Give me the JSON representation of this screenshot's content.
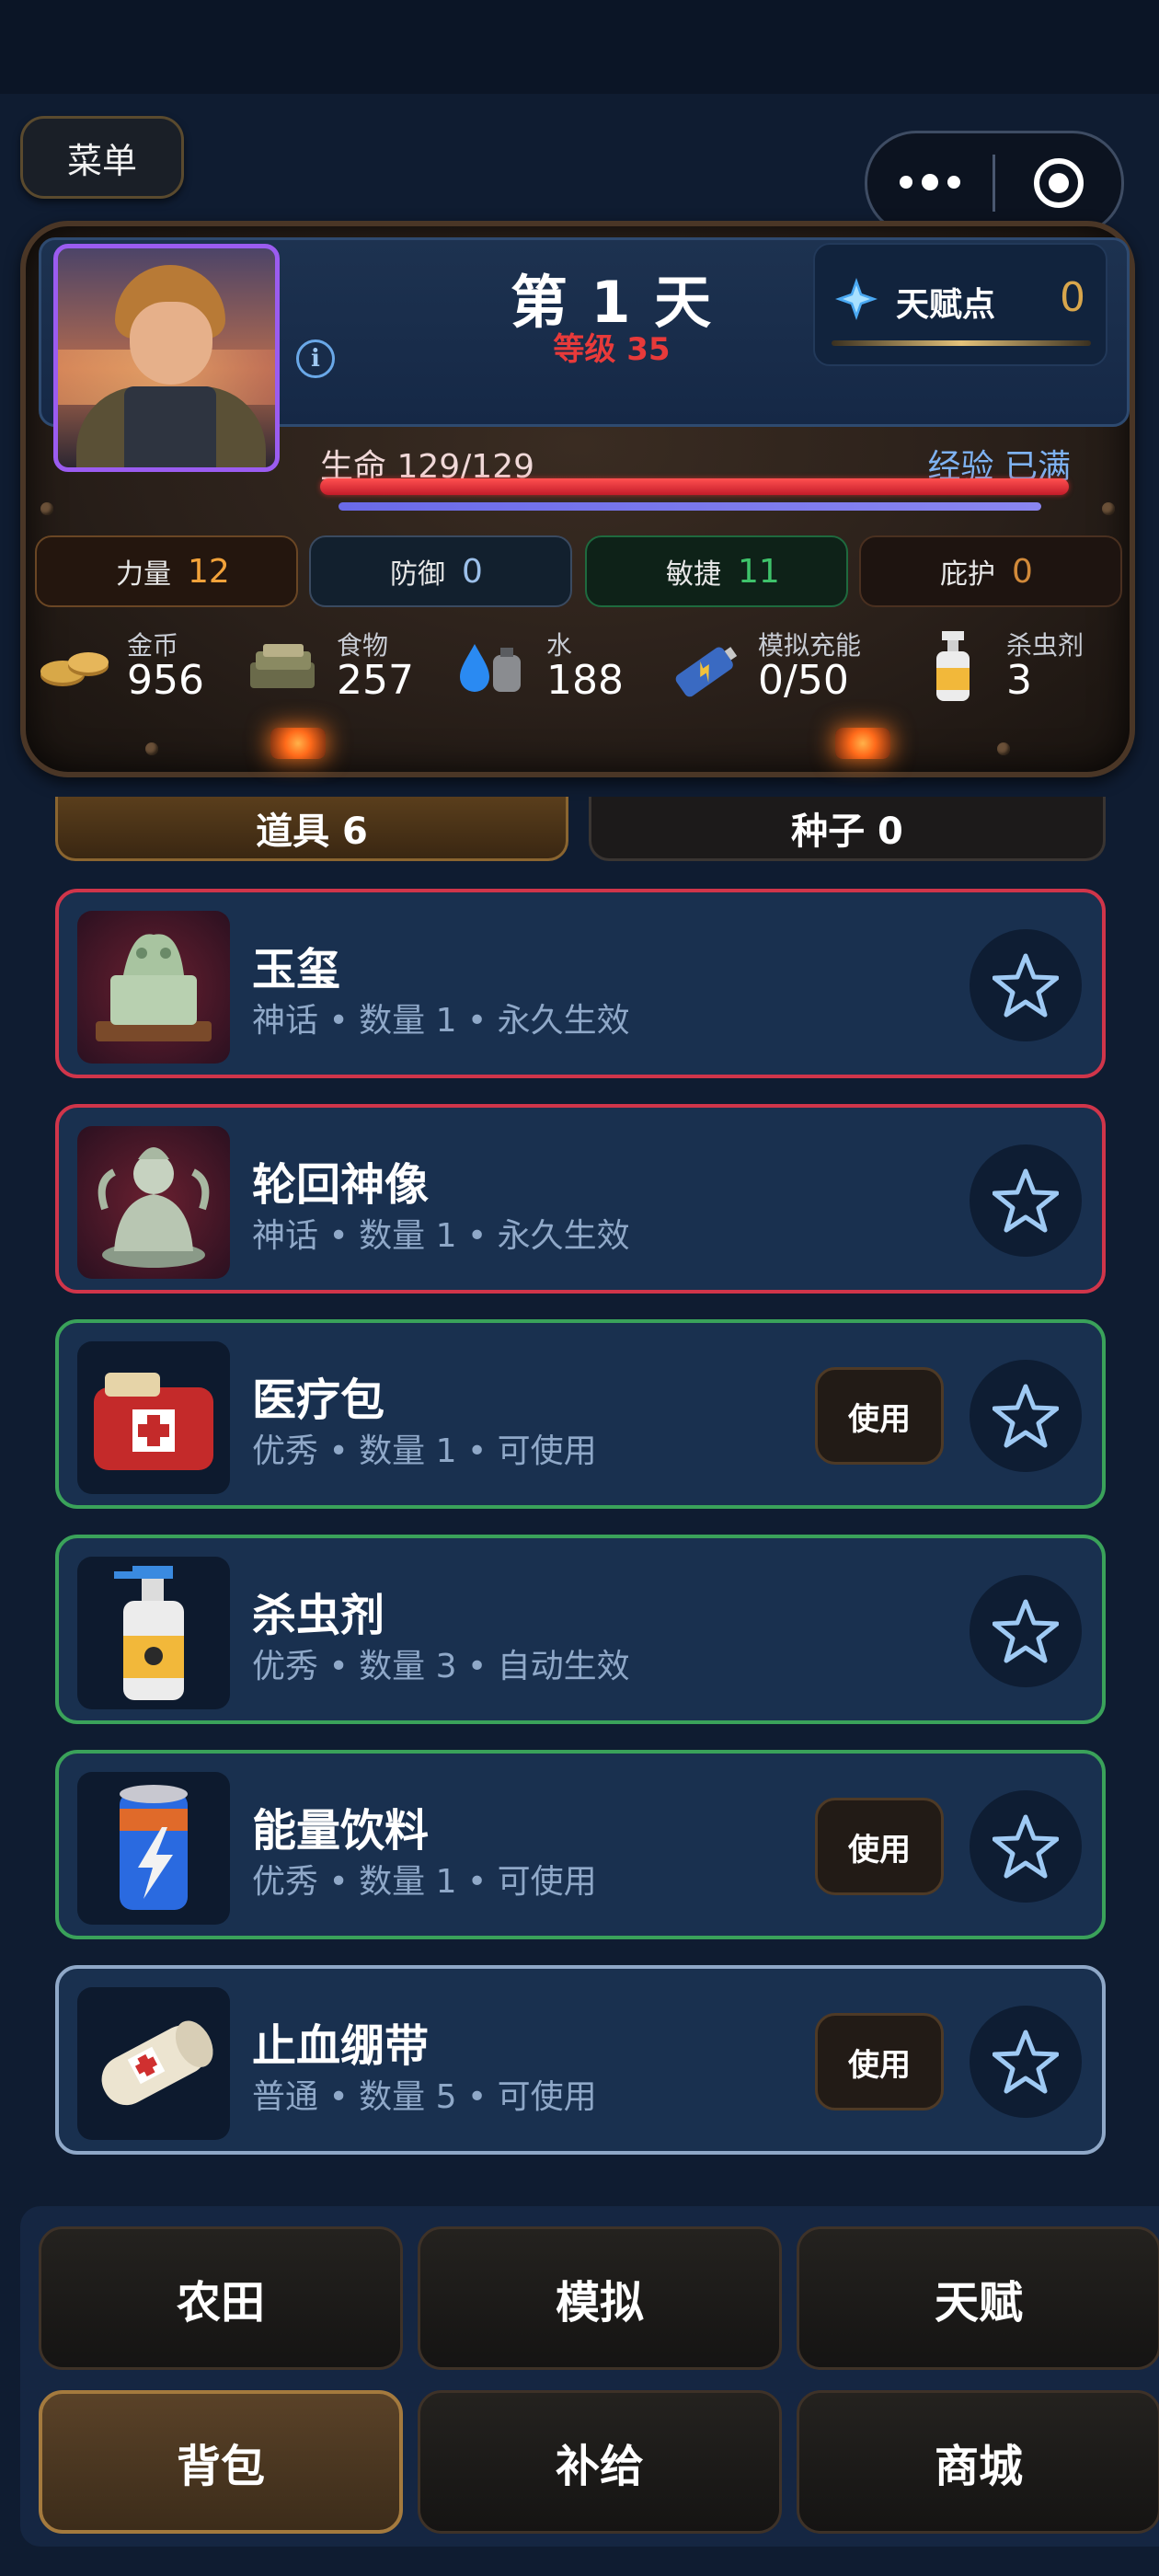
{
  "menu_label": "菜单",
  "player": {
    "day": "第 1 天",
    "level": "等级 35",
    "talent_label": "天赋点",
    "talent_points": "0",
    "hp_label": "生命 129/129",
    "exp_label": "经验 已满",
    "hp_fraction": 1.0,
    "exp_fraction": 1.0
  },
  "stats": [
    {
      "label": "力量",
      "value": "12"
    },
    {
      "label": "防御",
      "value": "0"
    },
    {
      "label": "敏捷",
      "value": "11"
    },
    {
      "label": "庇护",
      "value": "0"
    }
  ],
  "resources": [
    {
      "label": "金币",
      "value": "956",
      "icon": "coins-icon"
    },
    {
      "label": "食物",
      "value": "257",
      "icon": "food-icon"
    },
    {
      "label": "水",
      "value": "188",
      "icon": "water-icon"
    },
    {
      "label": "模拟充能",
      "value": "0/50",
      "icon": "battery-icon"
    },
    {
      "label": "杀虫剂",
      "value": "3",
      "icon": "spray-icon"
    }
  ],
  "tabs": [
    {
      "label": "道具 6",
      "active": true
    },
    {
      "label": "种子 0",
      "active": false
    }
  ],
  "items": [
    {
      "name": "玉玺",
      "rarity": "神话",
      "qty": "数量 1",
      "status": "永久生效",
      "usable": false,
      "icon": "jade-seal-icon"
    },
    {
      "name": "轮回神像",
      "rarity": "神话",
      "qty": "数量 1",
      "status": "永久生效",
      "usable": false,
      "icon": "buddha-statue-icon"
    },
    {
      "name": "医疗包",
      "rarity": "优秀",
      "qty": "数量 1",
      "status": "可使用",
      "usable": true,
      "icon": "medkit-icon"
    },
    {
      "name": "杀虫剂",
      "rarity": "优秀",
      "qty": "数量 3",
      "status": "自动生效",
      "usable": false,
      "icon": "spray-icon"
    },
    {
      "name": "能量饮料",
      "rarity": "优秀",
      "qty": "数量 1",
      "status": "可使用",
      "usable": true,
      "icon": "energy-drink-icon"
    },
    {
      "name": "止血绷带",
      "rarity": "普通",
      "qty": "数量 5",
      "status": "可使用",
      "usable": true,
      "icon": "bandage-icon"
    }
  ],
  "use_label": "使用",
  "separator": "•",
  "nav": [
    {
      "label": "农田",
      "active": false
    },
    {
      "label": "模拟",
      "active": false
    },
    {
      "label": "天赋",
      "active": false
    },
    {
      "label": "背包",
      "active": true
    },
    {
      "label": "补给",
      "active": false
    },
    {
      "label": "商城",
      "active": false
    }
  ],
  "colors": {
    "mythic": "#d0354a",
    "good": "#3aa25a",
    "normal": "#8fa8c8",
    "hp": "#e8303c",
    "level": "#e83a3a",
    "accent_gold": "#d8a64c"
  }
}
